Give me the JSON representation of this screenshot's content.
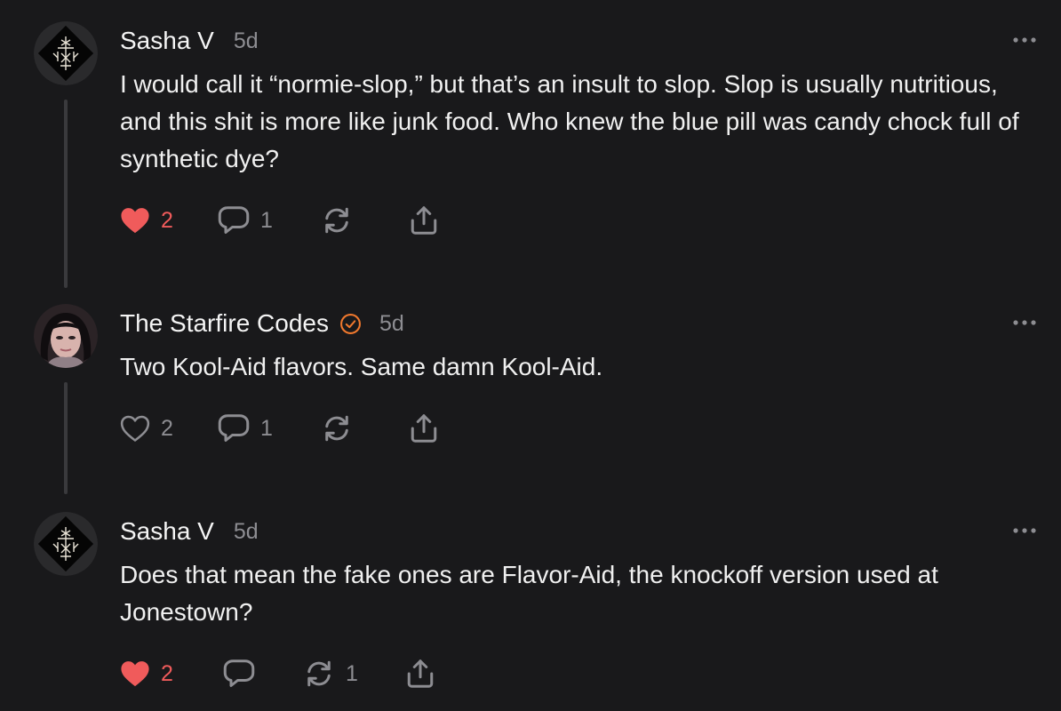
{
  "comments": [
    {
      "author": "Sasha V",
      "timestamp": "5d",
      "avatar_icon": "rune-sigil-icon",
      "verified": false,
      "text": "I would call it “normie-slop,” but that’s an insult to slop. Slop is usually nutritious, and this shit is more like junk food. Who knew the blue pill was candy chock full of synthetic dye?",
      "likes": "2",
      "liked": true,
      "replies": "1",
      "restacks": ""
    },
    {
      "author": "The Starfire Codes",
      "timestamp": "5d",
      "avatar_icon": "user-photo-avatar",
      "verified": true,
      "text": "Two Kool-Aid flavors. Same damn Kool-Aid.",
      "likes": "2",
      "liked": false,
      "replies": "1",
      "restacks": ""
    },
    {
      "author": "Sasha V",
      "timestamp": "5d",
      "avatar_icon": "rune-sigil-icon",
      "verified": false,
      "text": "Does that mean the fake ones are Flavor-Aid, the knockoff version used at Jonestown?",
      "likes": "2",
      "liked": true,
      "replies": "",
      "restacks": "1"
    }
  ],
  "colors": {
    "background": "#19191b",
    "liked": "#f05b5b",
    "muted": "#8d8d92",
    "verified": "#f0782d"
  }
}
